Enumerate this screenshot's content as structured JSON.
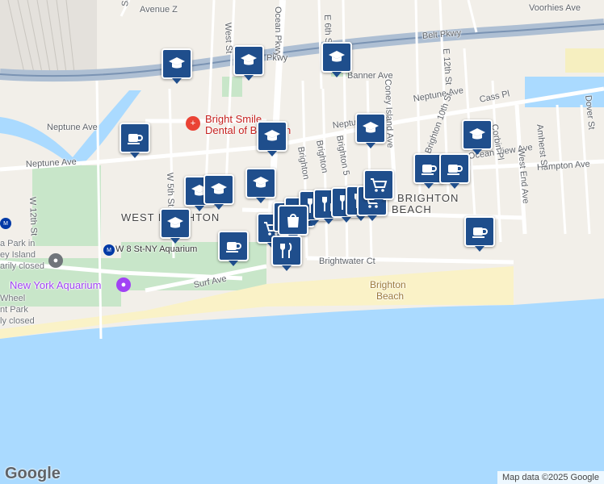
{
  "map": {
    "colors": {
      "land": "#f2efe9",
      "water": "#aadaff",
      "beach": "#faf2c7",
      "park": "#c8e6c9",
      "marker": "#1f4e8c",
      "road": "#ffffff",
      "highway": "#aebfd3"
    },
    "streets": {
      "avenue_z": "Avenue Z",
      "voorhies_ave": "Voorhies Ave",
      "belt_pkwy_1": "Belt Pkwy",
      "belt_pkwy_2": "Pkwy",
      "banner_ave": "Banner Ave",
      "neptune_ave_w": "Neptune Ave",
      "neptune_ave_sw": "Neptune Ave",
      "neptune_ave_mid": "Neptune Ave",
      "neptune_ave_e": "Neptune Ave",
      "cass_pl": "Cass Pl",
      "hampton_ave": "Hampton Ave",
      "ocean_view_ave": "Ocean View Ave",
      "surf_ave": "Surf Ave",
      "brightwater_ct": "Brightwater Ct",
      "coney_island_ave": "Coney Island Ave",
      "west_end_ave": "West End Ave",
      "w_12th_st": "W 12th St",
      "w_5th_st": "W 5th St",
      "e_6th_st": "E 6th St",
      "e_12th_st": "E 12th St",
      "brighton_10th_st": "Brighton 10th St",
      "corbin_pl": "Corbin Pl",
      "amherst_st": "Amherst St",
      "dover_st": "Dover St",
      "brighton_a": "Brighton",
      "brighton_b": "Brighton",
      "brighton_5": "Brighton 5",
      "ocean_pkwy": "Ocean Pkwy",
      "west_st": "West St",
      "shell_rd": "Shell Rd"
    },
    "areas": {
      "west_brighton": "WEST BRIGHTON",
      "brighton_beach_1": "BRIGHTON",
      "brighton_beach_2": "BEACH",
      "beach_1": "Brighton",
      "beach_2": "Beach"
    },
    "pois": {
      "aquarium": "New York Aquarium",
      "dental_1": "Bright Smile",
      "dental_2": "Dental of Brooklyn",
      "luna_park_1": "a Park in",
      "luna_park_2": "ey Island",
      "luna_park_3": "arily closed",
      "wheel_1": "Wheel",
      "wheel_2": "nt Park",
      "wheel_3": "ly closed",
      "station": "W 8 St-NY Aquarium"
    },
    "logo": "Google",
    "attribution": "Map data ©2025 Google"
  },
  "markers": [
    {
      "icon": "school"
    },
    {
      "icon": "school"
    },
    {
      "icon": "school"
    },
    {
      "icon": "cafe"
    },
    {
      "icon": "school"
    },
    {
      "icon": "school"
    },
    {
      "icon": "school"
    },
    {
      "icon": "school"
    },
    {
      "icon": "school"
    },
    {
      "icon": "school"
    },
    {
      "icon": "school"
    },
    {
      "icon": "cafe"
    },
    {
      "icon": "cafe"
    },
    {
      "icon": "cafe"
    },
    {
      "icon": "cafe"
    },
    {
      "icon": "grocery"
    },
    {
      "icon": "grocery"
    },
    {
      "icon": "restaurant"
    },
    {
      "icon": "restaurant"
    },
    {
      "icon": "restaurant"
    },
    {
      "icon": "restaurant"
    },
    {
      "icon": "restaurant"
    },
    {
      "icon": "grocery"
    },
    {
      "icon": "grocery"
    },
    {
      "icon": "shopping"
    },
    {
      "icon": "restaurant"
    }
  ]
}
